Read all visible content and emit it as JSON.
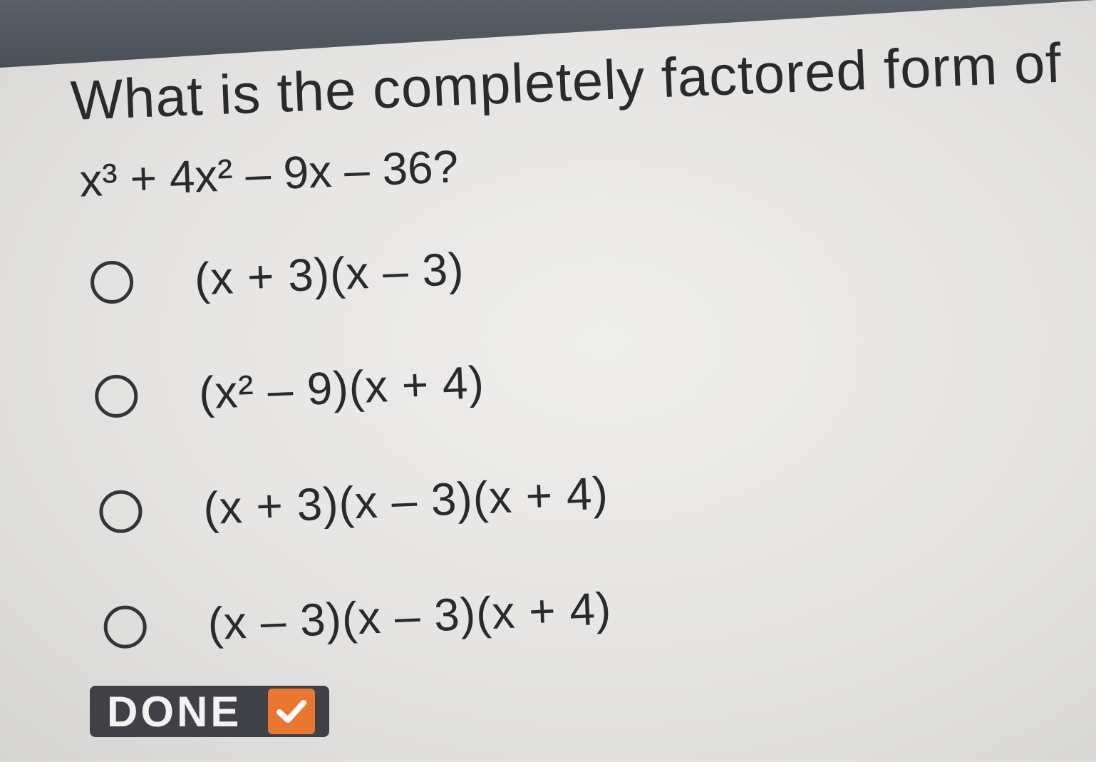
{
  "question": {
    "text": "What is the completely factored form of",
    "expression": "x³ + 4x² – 9x – 36?"
  },
  "options": [
    {
      "label": "(x + 3)(x – 3)"
    },
    {
      "label": "(x² – 9)(x + 4)"
    },
    {
      "label": "(x + 3)(x – 3)(x + 4)"
    },
    {
      "label": "(x – 3)(x – 3)(x + 4)"
    }
  ],
  "done_button": {
    "label": "DONE",
    "icon": "checkmark-icon"
  },
  "colors": {
    "accent": "#e9772f",
    "button_bg": "#3f4146",
    "text": "#2a2a2c",
    "top_bar": "#4f555d"
  }
}
